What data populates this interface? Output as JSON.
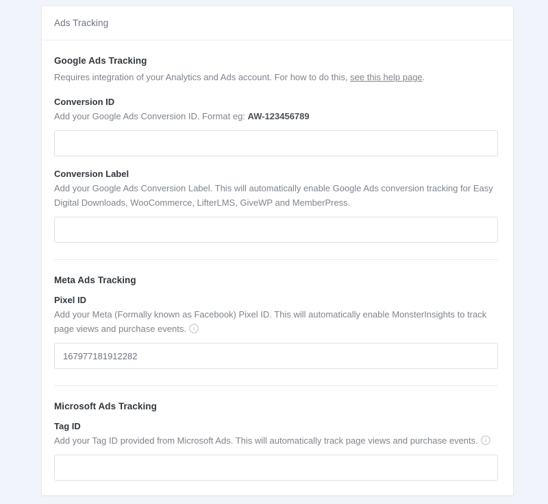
{
  "card": {
    "header_title": "Ads Tracking"
  },
  "google": {
    "section_title": "Google Ads Tracking",
    "desc_before": "Requires integration of your Analytics and Ads account. For how to do this, ",
    "desc_link": "see this help page",
    "desc_after": ".",
    "conversion_id": {
      "label": "Conversion ID",
      "desc_prefix": "Add your Google Ads Conversion ID. Format eg: ",
      "desc_strong": "AW-123456789",
      "value": "",
      "placeholder": ""
    },
    "conversion_label": {
      "label": "Conversion Label",
      "desc": "Add your Google Ads Conversion Label. This will automatically enable Google Ads conversion tracking for Easy Digital Downloads, WooCommerce, LifterLMS, GiveWP and MemberPress.",
      "value": "",
      "placeholder": ""
    }
  },
  "meta": {
    "section_title": "Meta Ads Tracking",
    "pixel_id": {
      "label": "Pixel ID",
      "desc": "Add your Meta (Formally known as Facebook) Pixel ID. This will automatically enable MonsterInsights to track page views and purchase events.",
      "info_icon": "info-circle-icon",
      "value": "167977181912282",
      "placeholder": ""
    }
  },
  "microsoft": {
    "section_title": "Microsoft Ads Tracking",
    "tag_id": {
      "label": "Tag ID",
      "desc": "Add your Tag ID provided from Microsoft Ads. This will automatically track page views and purchase events.",
      "info_icon": "info-circle-icon",
      "value": "",
      "placeholder": ""
    }
  },
  "colors": {
    "page_background": "#f2f4fb",
    "card_background": "#ffffff",
    "heading_text": "#32373c",
    "body_text": "#7e848c",
    "border": "#dcdfe4"
  }
}
